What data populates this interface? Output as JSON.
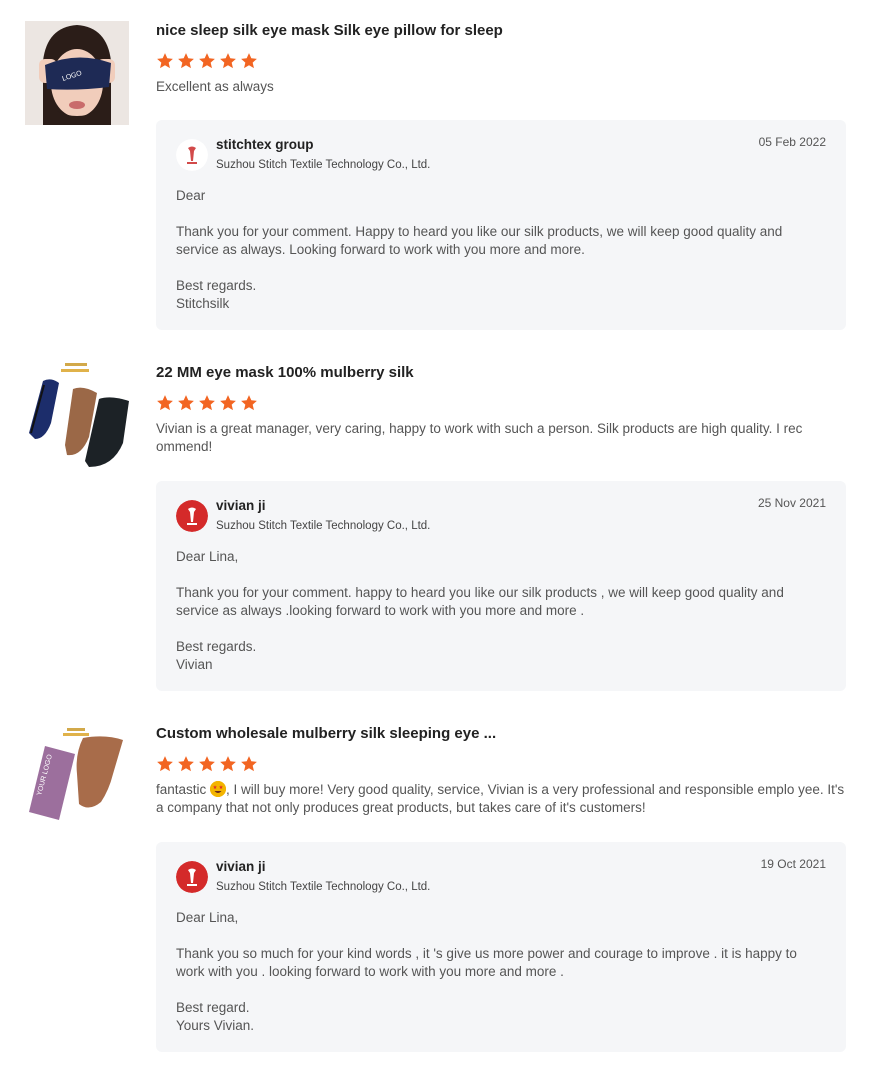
{
  "colors": {
    "star": "#f26522",
    "reply_bg": "#f5f6f8",
    "avatar_red": "#d42a2a"
  },
  "reviews": [
    {
      "title": "nice sleep silk eye mask Silk eye pillow for sleep",
      "rating": 5,
      "comment": "Excellent as always",
      "thumb_logo_text": "LOGO",
      "reply": {
        "name": "stitchtex group",
        "company": "Suzhou Stitch Textile Technology Co., Ltd.",
        "date": "05 Feb 2022",
        "greeting": "Dear",
        "message": "Thank you for your comment. Happy to heard you like our silk products, we will keep good quality and service as always. Looking forward to work with you more and more.",
        "closing": "Best regards.",
        "signature": "Stitchsilk"
      }
    },
    {
      "title": "22 MM eye mask 100% mulberry silk",
      "rating": 5,
      "comment": "Vivian is a great manager, very caring, happy to work with such a person. Silk products are high quality. I rec ommend!",
      "reply": {
        "name": "vivian ji",
        "company": "Suzhou Stitch Textile Technology Co., Ltd.",
        "date": "25 Nov 2021",
        "greeting": "Dear Lina,",
        "message": "Thank you for your comment. happy to heard you like our silk products , we will keep good quality and service as always .looking forward to work with you more and more .",
        "closing": "Best regards.",
        "signature": "Vivian"
      }
    },
    {
      "title": "Custom wholesale mulberry silk sleeping eye ...",
      "rating": 5,
      "comment_before_emoji": "fantastic",
      "comment_after_emoji": ", I will buy more! Very good quality, service, Vivian is a very professional and responsible emplo yee. It's a company that not only produces great products, but takes care of it's customers!",
      "thumb_logo_text": "YOUR LOGO",
      "reply": {
        "name": "vivian ji",
        "company": "Suzhou Stitch Textile Technology Co., Ltd.",
        "date": "19 Oct 2021",
        "greeting": "Dear Lina,",
        "message": "Thank you so much for your kind words , it 's give us more power and courage to improve . it is happy to work with you . looking forward to work with you more and more .",
        "closing": "Best regard.",
        "signature": "Yours Vivian."
      }
    }
  ]
}
